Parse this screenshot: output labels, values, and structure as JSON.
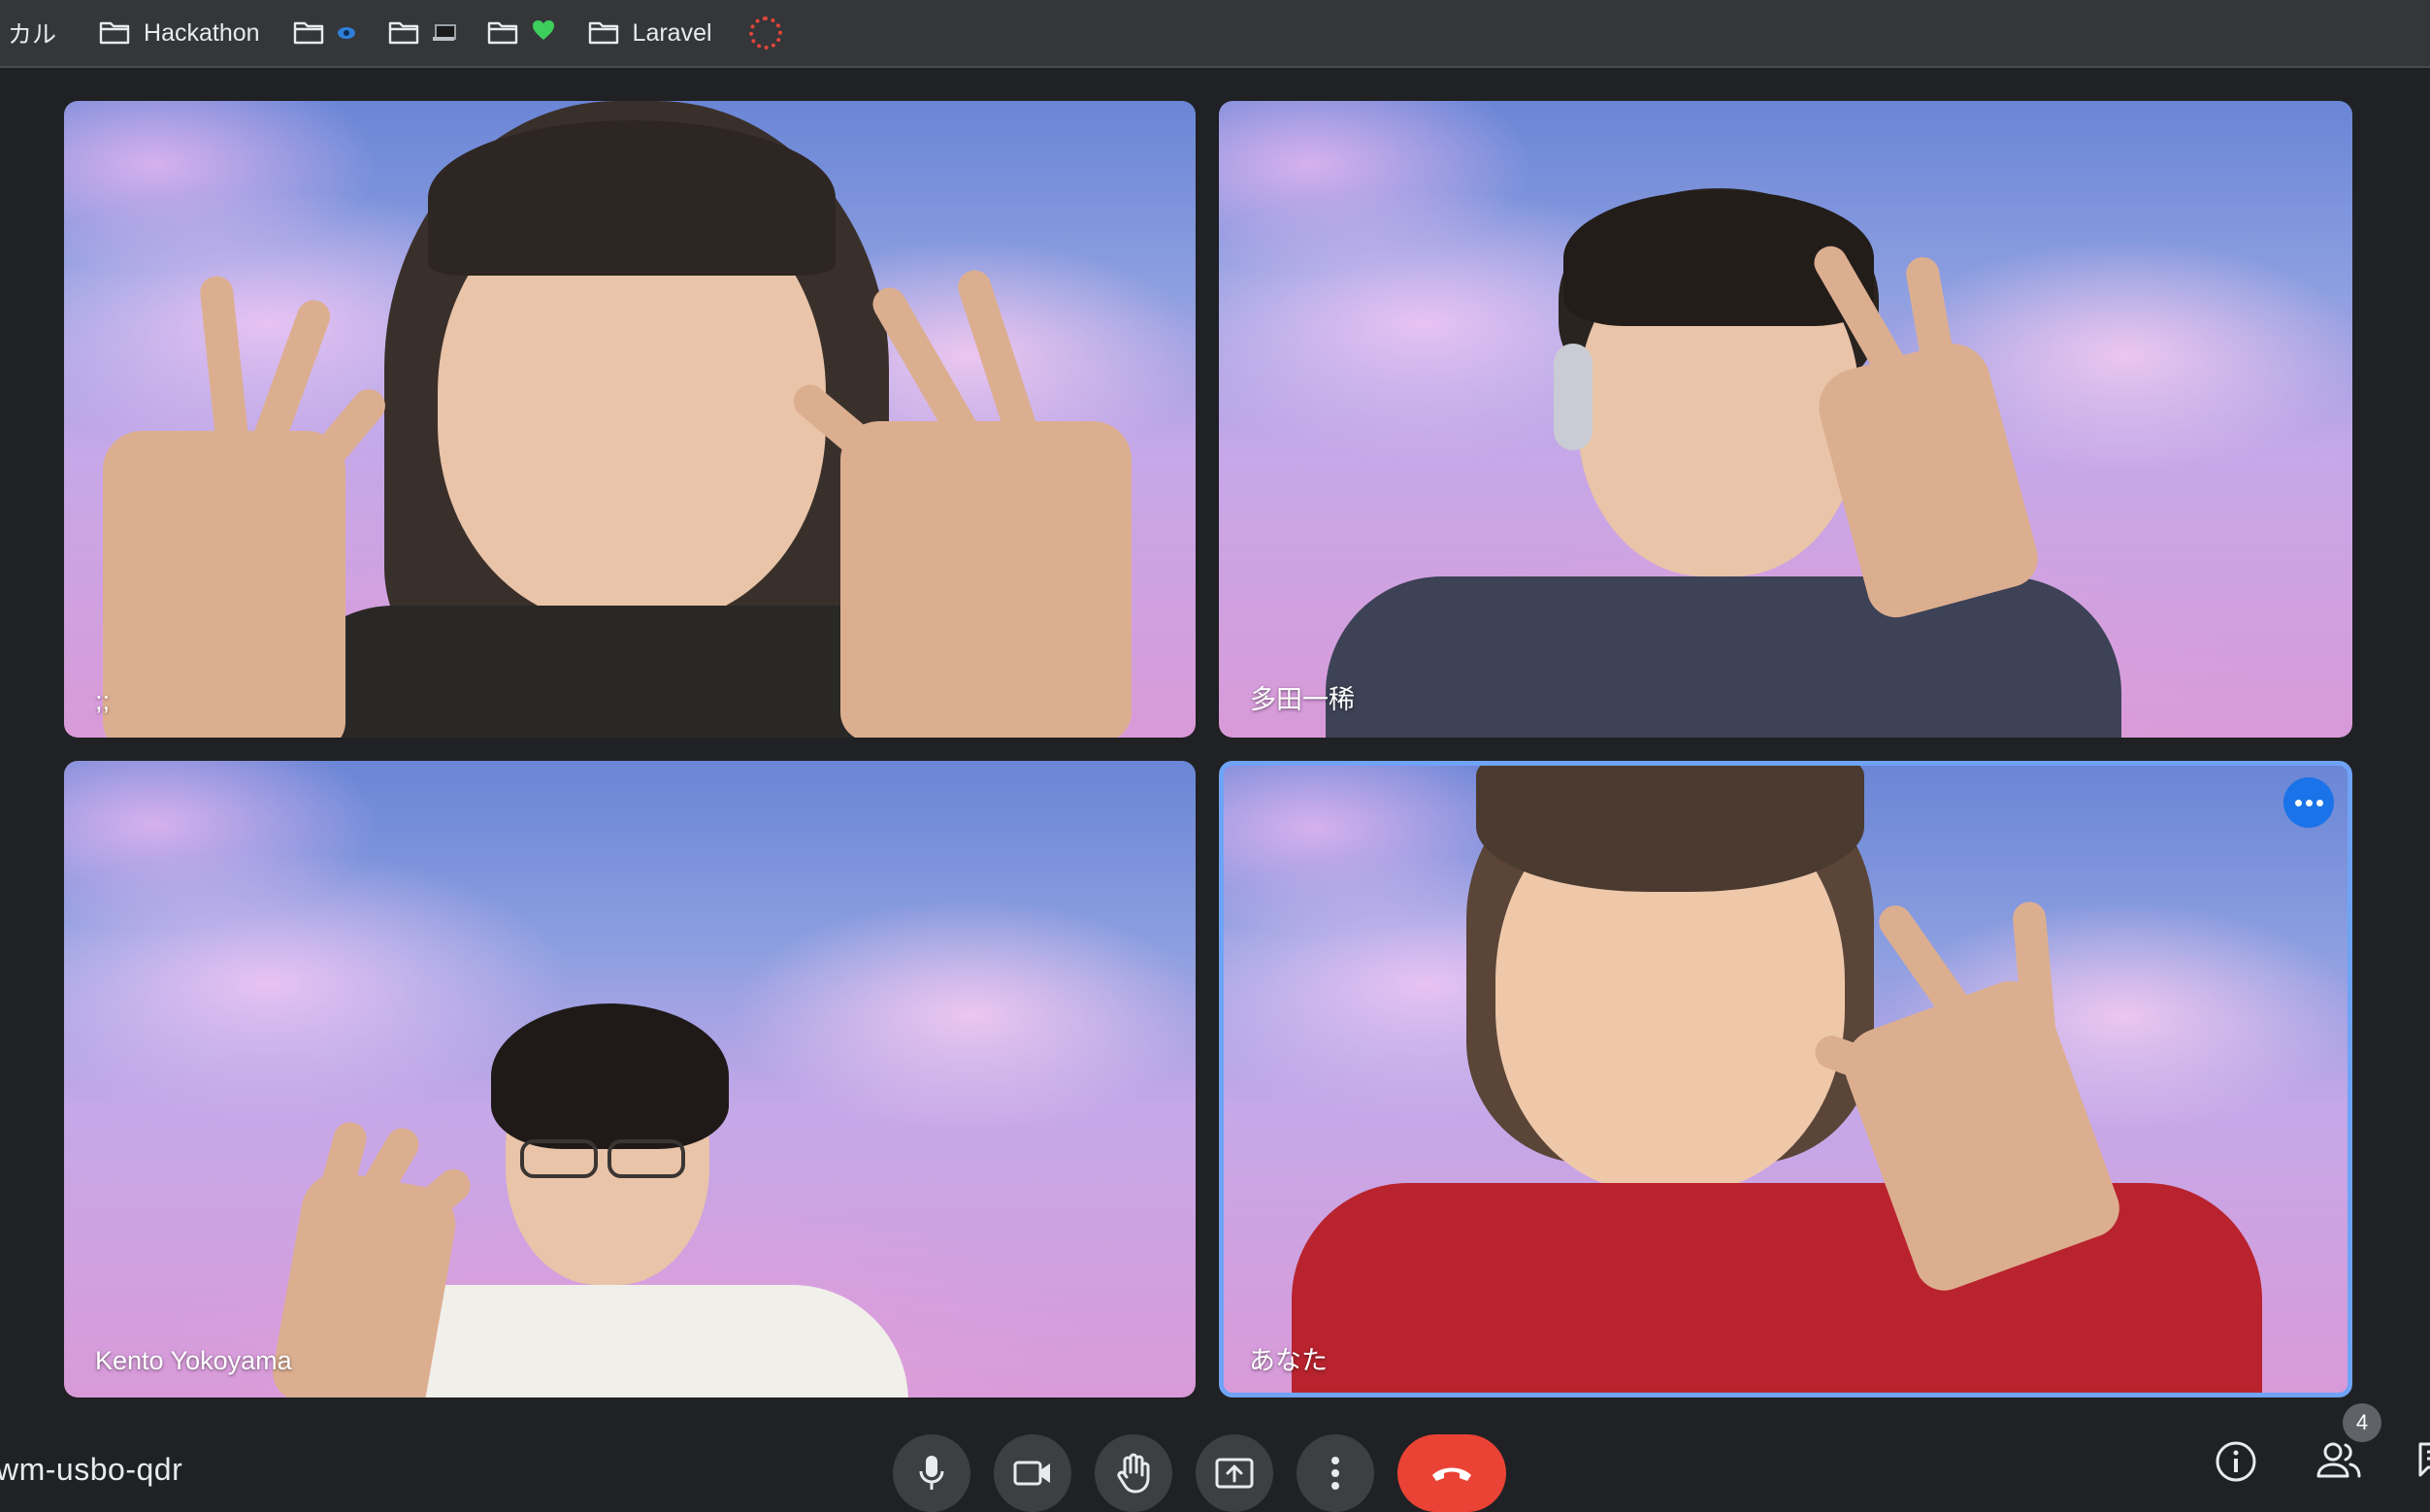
{
  "bookmarks": {
    "partial_label": "カル",
    "items": [
      {
        "label": "Hackathon",
        "icon": "folder-icon"
      },
      {
        "label": "",
        "icon": "folder-icon",
        "emoji": "eye-emoji"
      },
      {
        "label": "",
        "icon": "folder-icon",
        "emoji": "laptop-emoji"
      },
      {
        "label": "",
        "icon": "folder-icon",
        "emoji": "green-heart-emoji"
      },
      {
        "label": "Laravel",
        "icon": "folder-icon"
      }
    ],
    "favicon": "red-dotted-circle-favicon"
  },
  "participants": [
    {
      "name": ";;",
      "active": false
    },
    {
      "name": "多田一稀",
      "active": false
    },
    {
      "name": "Kento Yokoyama",
      "active": false
    },
    {
      "name": "あなた",
      "active": true
    }
  ],
  "meeting": {
    "code": "wm-usbo-qdr"
  },
  "controls": {
    "buttons": [
      "mic-icon",
      "camera-icon",
      "raise-hand-icon",
      "present-screen-icon",
      "more-options-icon",
      "hang-up-icon"
    ]
  },
  "right_tools": {
    "info_icon": "info-icon",
    "people_icon": "people-icon",
    "people_count": "4",
    "chat_icon": "chat-icon"
  },
  "colors": {
    "background": "#202124",
    "active_border": "#6fa3f5",
    "hangup": "#ea4335",
    "control_button": "#3c4043",
    "more_button": "#1a73e8"
  }
}
